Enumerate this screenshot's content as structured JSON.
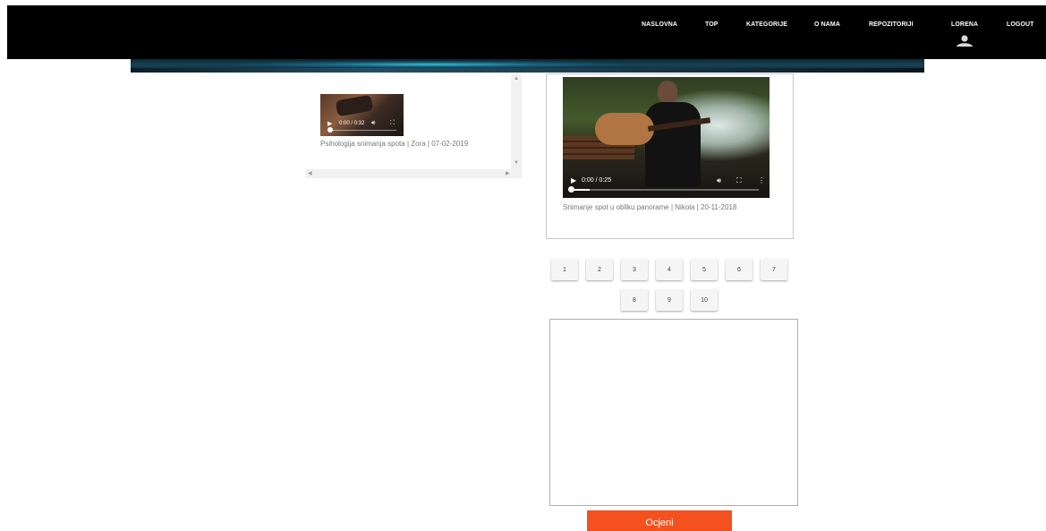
{
  "nav": {
    "items": [
      "NASLOVNA",
      "TOP",
      "KATEGORIJE",
      "O NAMA",
      "REPOZITORIJI"
    ],
    "user_label": "LORENA",
    "logout_label": "LOGOUT"
  },
  "left_video": {
    "time": "0:00 / 0:32",
    "caption": "Psihologija snimanja spota | Zora | 07-02-2019"
  },
  "main_video": {
    "time": "0:00 / 0:25",
    "caption": "Snimanje spot u obliku panorame  | Nikola | 20-11-2018"
  },
  "rating": {
    "options": [
      "1",
      "2",
      "3",
      "4",
      "5",
      "6",
      "7",
      "8",
      "9",
      "10"
    ]
  },
  "comment": {
    "value": ""
  },
  "submit_label": "Ocjeni",
  "colors": {
    "accent": "#f4511e",
    "topbar": "#000000"
  },
  "icons": [
    "user-icon",
    "play-icon",
    "volume-icon",
    "fullscreen-icon",
    "more-options-icon"
  ]
}
